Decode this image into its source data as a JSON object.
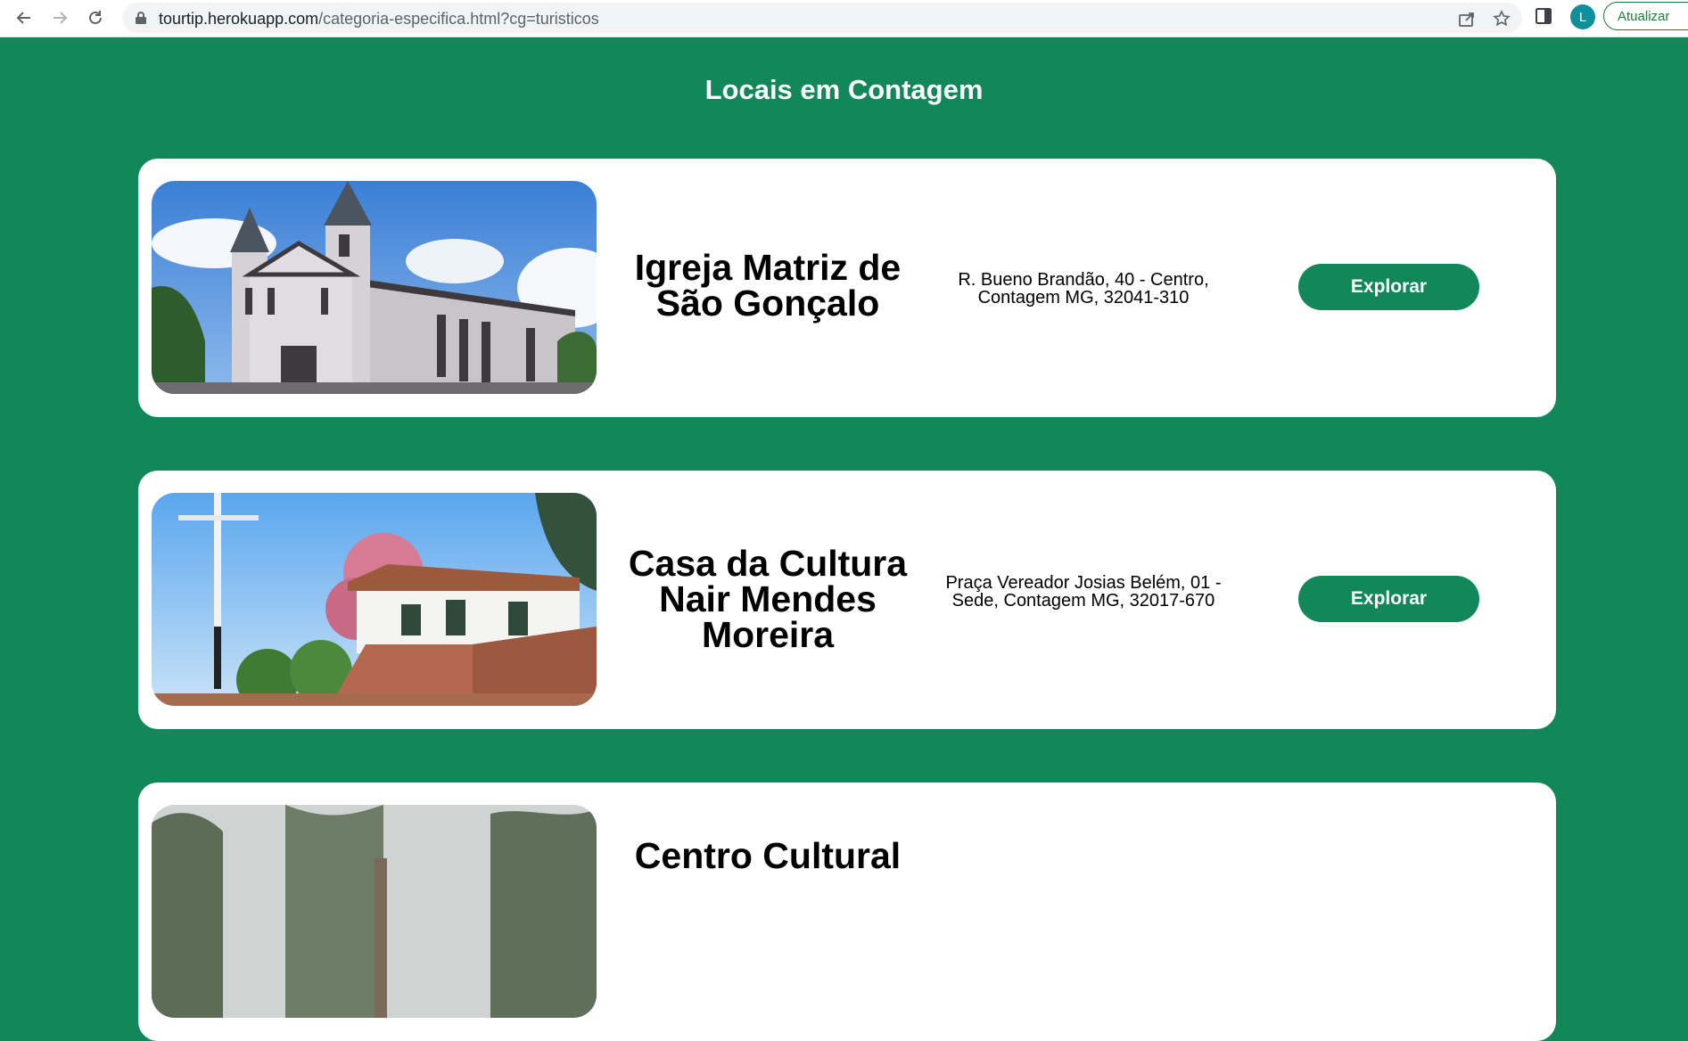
{
  "browser": {
    "url_host": "tourtip.herokuapp.com",
    "url_path": "/categoria-especifica.html?cg=turisticos",
    "avatar_letter": "L",
    "update_label": "Atualizar"
  },
  "page": {
    "title": "Locais em Contagem"
  },
  "places": [
    {
      "name": "Igreja Matriz de São Gonçalo",
      "address": "R. Bueno Brandão, 40 - Centro, Contagem MG, 32041-310",
      "button": "Explorar"
    },
    {
      "name": "Casa da Cultura Nair Mendes Moreira",
      "address": "Praça Vereador Josias Belém, 01 - Sede, Contagem MG, 32017-670",
      "button": "Explorar"
    },
    {
      "name": "Centro Cultural"
    }
  ],
  "colors": {
    "background": "#12885a",
    "button": "#12885a",
    "card": "#ffffff"
  }
}
